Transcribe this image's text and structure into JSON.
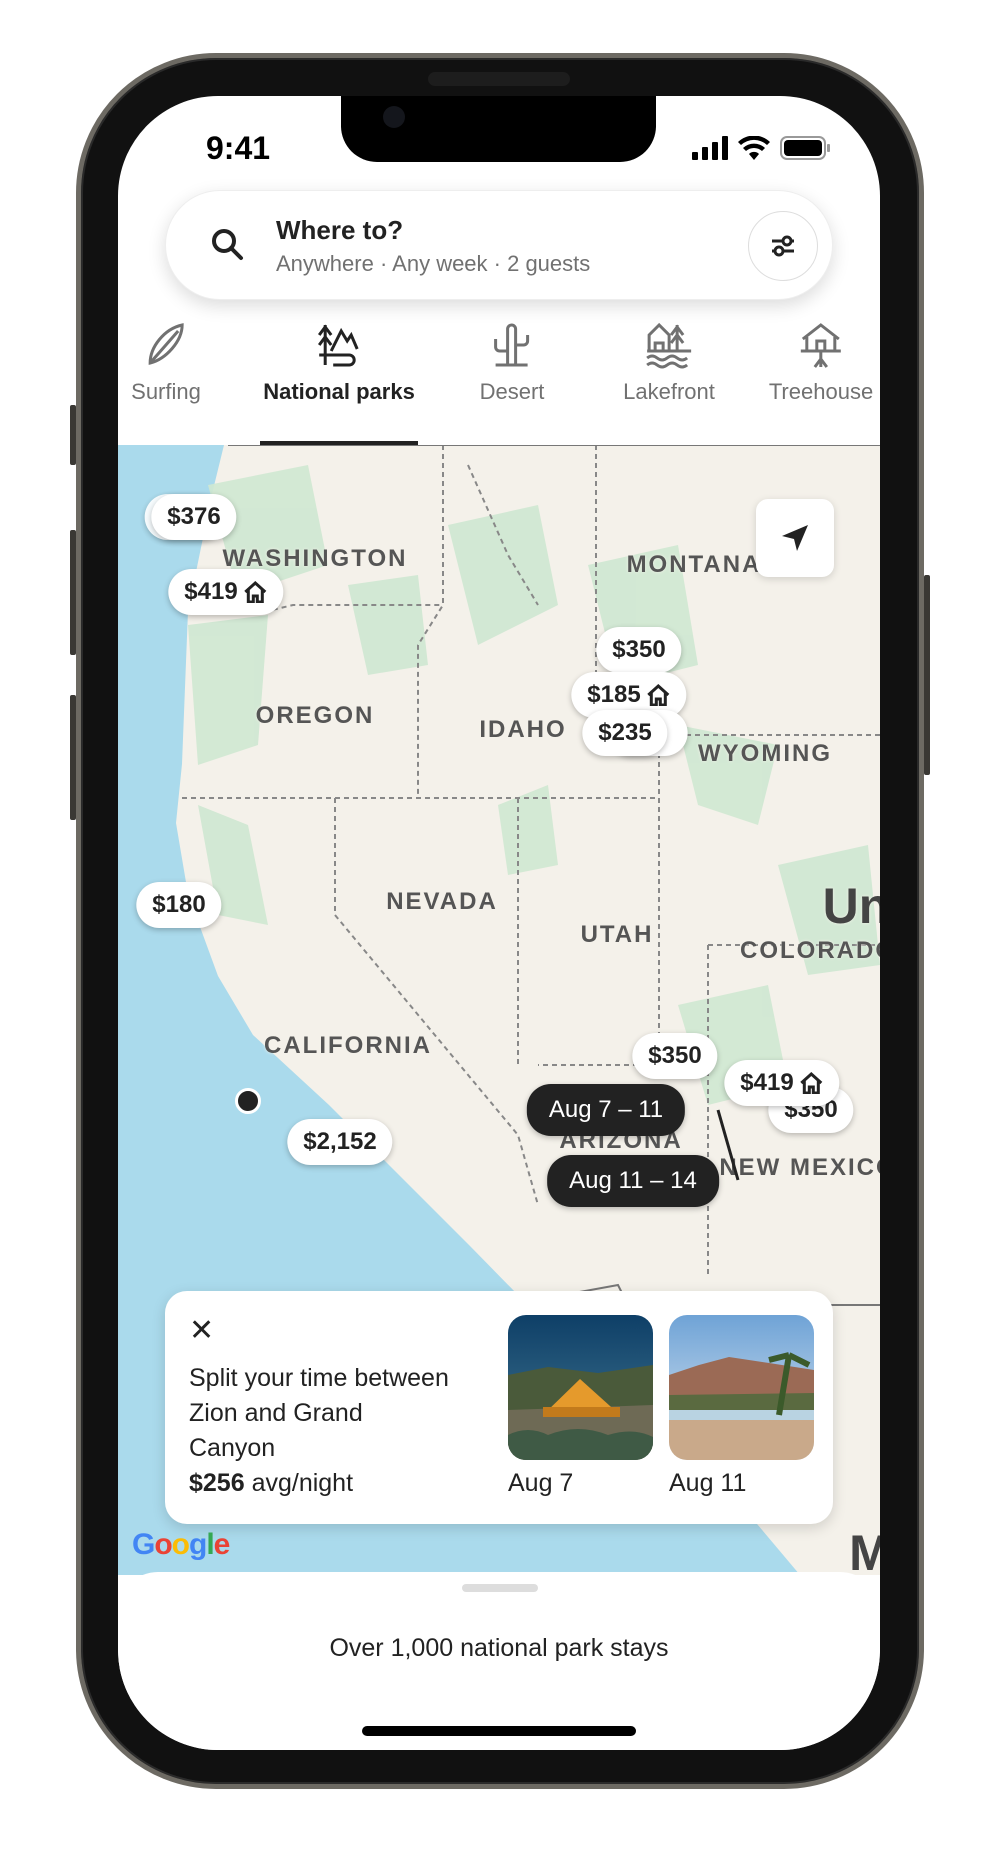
{
  "status_bar": {
    "time": "9:41"
  },
  "search": {
    "title": "Where to?",
    "subtitle": "Anywhere · Any week · 2 guests"
  },
  "categories": [
    {
      "label": "Surfing",
      "icon": "surfboard-icon",
      "active": false
    },
    {
      "label": "National parks",
      "icon": "national-park-icon",
      "active": true
    },
    {
      "label": "Desert",
      "icon": "cactus-icon",
      "active": false
    },
    {
      "label": "Lakefront",
      "icon": "lakefront-icon",
      "active": false
    },
    {
      "label": "Treehouse",
      "icon": "treehouse-icon",
      "active": false
    }
  ],
  "map": {
    "states": [
      "WASHINGTON",
      "MONTANA",
      "OREGON",
      "IDAHO",
      "WYOMING",
      "NEVADA",
      "UTAH",
      "COLORADO",
      "CALIFORNIA",
      "ARIZONA",
      "NEW MEXICO",
      "Un",
      "M"
    ],
    "pins": [
      {
        "price": "$376",
        "home_icon": false
      },
      {
        "price": "$419",
        "home_icon": true
      },
      {
        "price": "$350",
        "home_icon": false
      },
      {
        "price": "$185",
        "home_icon": true
      },
      {
        "price": "$235",
        "home_icon": false
      },
      {
        "price": "$180",
        "home_icon": false
      },
      {
        "price": "$350",
        "home_icon": false
      },
      {
        "price": "$419",
        "home_icon": true
      },
      {
        "price": "$350",
        "home_icon": false
      },
      {
        "price": "$2,152",
        "home_icon": false
      }
    ],
    "date_pins": [
      "Aug 7 – 11",
      "Aug 11 – 14"
    ],
    "attribution": "Google"
  },
  "card": {
    "title": "Split your time between Zion and Grand Canyon",
    "price": "$256",
    "price_suffix": " avg/night",
    "stays": [
      {
        "date": "Aug 7"
      },
      {
        "date": "Aug 11"
      }
    ]
  },
  "sheet": {
    "text": "Over 1,000 national park stays"
  }
}
